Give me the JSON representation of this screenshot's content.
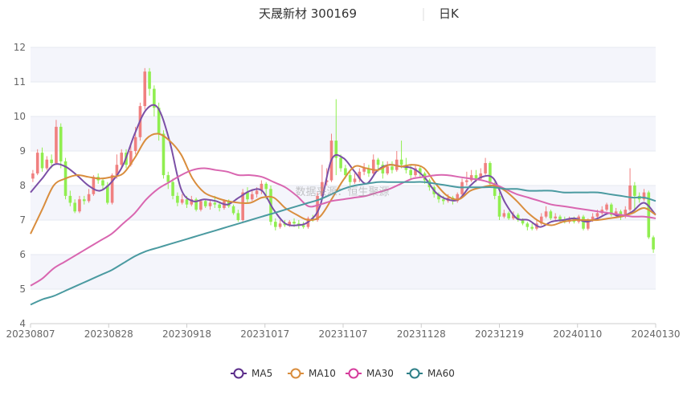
{
  "chart_data": {
    "type": "candlestick",
    "title": "天晟新材 300169",
    "period_label": "日K",
    "watermark": "数据来源：恒生聚源",
    "ylim": [
      4,
      12
    ],
    "y_ticks": [
      4,
      5,
      6,
      7,
      8,
      9,
      10,
      11,
      12
    ],
    "x_tick_labels": [
      "20230807",
      "20230828",
      "20230918",
      "20231017",
      "20231107",
      "20231128",
      "20231219",
      "20240110",
      "20240130"
    ],
    "colors": {
      "up": "#f08080",
      "down": "#90ee50",
      "grid": "#e6e9f2",
      "band": "#f4f5fb"
    },
    "candles": [
      [
        8.2,
        8.35,
        8.1,
        8.45
      ],
      [
        8.35,
        8.95,
        8.3,
        9.05
      ],
      [
        8.95,
        8.5,
        8.4,
        9.1
      ],
      [
        8.5,
        8.75,
        8.45,
        8.85
      ],
      [
        8.75,
        8.65,
        8.5,
        8.9
      ],
      [
        8.65,
        9.7,
        8.6,
        9.9
      ],
      [
        9.7,
        8.7,
        8.5,
        9.8
      ],
      [
        8.7,
        7.7,
        7.6,
        8.8
      ],
      [
        7.7,
        7.5,
        7.4,
        7.85
      ],
      [
        7.5,
        7.25,
        7.2,
        7.6
      ],
      [
        7.25,
        7.6,
        7.2,
        7.7
      ],
      [
        7.6,
        7.55,
        7.45,
        7.7
      ],
      [
        7.55,
        7.75,
        7.5,
        7.9
      ],
      [
        7.75,
        8.25,
        7.7,
        8.3
      ],
      [
        8.25,
        8.15,
        8.05,
        8.35
      ],
      [
        8.15,
        8.0,
        7.9,
        8.2
      ],
      [
        8.0,
        7.5,
        7.45,
        8.1
      ],
      [
        7.5,
        8.3,
        7.45,
        8.35
      ],
      [
        8.3,
        8.6,
        8.2,
        8.9
      ],
      [
        8.6,
        8.95,
        8.5,
        9.05
      ],
      [
        8.95,
        8.6,
        8.5,
        9.05
      ],
      [
        8.6,
        9.0,
        8.55,
        9.2
      ],
      [
        9.0,
        9.4,
        8.9,
        9.7
      ],
      [
        9.4,
        10.3,
        9.3,
        10.4
      ],
      [
        10.3,
        11.3,
        10.2,
        11.4
      ],
      [
        11.3,
        10.8,
        10.6,
        11.4
      ],
      [
        10.8,
        10.25,
        10.0,
        10.9
      ],
      [
        10.25,
        9.5,
        9.3,
        10.4
      ],
      [
        9.5,
        8.3,
        8.2,
        9.6
      ],
      [
        8.3,
        8.1,
        7.9,
        8.4
      ],
      [
        8.1,
        7.7,
        7.6,
        8.2
      ],
      [
        7.7,
        7.5,
        7.4,
        7.8
      ],
      [
        7.5,
        7.6,
        7.45,
        7.75
      ],
      [
        7.6,
        7.45,
        7.35,
        7.7
      ],
      [
        7.45,
        7.6,
        7.4,
        7.7
      ],
      [
        7.6,
        7.3,
        7.25,
        7.65
      ],
      [
        7.3,
        7.55,
        7.25,
        7.6
      ],
      [
        7.55,
        7.4,
        7.35,
        7.6
      ],
      [
        7.4,
        7.5,
        7.3,
        7.6
      ],
      [
        7.5,
        7.45,
        7.35,
        7.7
      ],
      [
        7.45,
        7.35,
        7.25,
        7.5
      ],
      [
        7.35,
        7.55,
        7.3,
        7.6
      ],
      [
        7.55,
        7.4,
        7.35,
        7.6
      ],
      [
        7.4,
        7.2,
        7.15,
        7.45
      ],
      [
        7.2,
        7.0,
        6.95,
        7.3
      ],
      [
        7.0,
        7.8,
        6.95,
        7.9
      ],
      [
        7.8,
        7.6,
        7.5,
        7.95
      ],
      [
        7.6,
        7.75,
        7.55,
        7.9
      ],
      [
        7.75,
        7.85,
        7.65,
        7.95
      ],
      [
        7.85,
        8.05,
        7.75,
        8.15
      ],
      [
        8.05,
        7.9,
        7.6,
        8.1
      ],
      [
        7.9,
        6.95,
        6.85,
        8.0
      ],
      [
        6.95,
        6.8,
        6.7,
        7.05
      ],
      [
        6.8,
        6.9,
        6.75,
        7.0
      ],
      [
        6.9,
        6.85,
        6.8,
        7.0
      ],
      [
        6.85,
        6.95,
        6.8,
        7.0
      ],
      [
        6.95,
        6.9,
        6.8,
        7.05
      ],
      [
        6.9,
        6.85,
        6.75,
        7.0
      ],
      [
        6.85,
        6.8,
        6.75,
        6.95
      ],
      [
        6.8,
        7.05,
        6.75,
        7.1
      ],
      [
        7.05,
        7.0,
        6.95,
        7.15
      ],
      [
        7.0,
        7.7,
        6.95,
        7.8
      ],
      [
        7.7,
        8.1,
        7.6,
        8.6
      ],
      [
        8.1,
        8.15,
        8.0,
        8.5
      ],
      [
        8.15,
        9.3,
        8.1,
        9.5
      ],
      [
        9.3,
        8.8,
        8.3,
        10.5
      ],
      [
        8.8,
        8.5,
        8.4,
        8.9
      ],
      [
        8.5,
        8.3,
        8.2,
        8.6
      ],
      [
        8.3,
        8.1,
        8.0,
        8.4
      ],
      [
        8.1,
        8.2,
        8.05,
        8.35
      ],
      [
        8.2,
        8.4,
        8.1,
        8.5
      ],
      [
        8.4,
        8.5,
        8.3,
        8.65
      ],
      [
        8.5,
        8.35,
        8.25,
        8.6
      ],
      [
        8.35,
        8.75,
        8.3,
        8.9
      ],
      [
        8.75,
        8.6,
        8.4,
        8.8
      ],
      [
        8.6,
        8.35,
        8.2,
        8.7
      ],
      [
        8.35,
        8.55,
        8.3,
        8.7
      ],
      [
        8.55,
        8.45,
        8.35,
        8.7
      ],
      [
        8.45,
        8.75,
        8.4,
        9.0
      ],
      [
        8.75,
        8.6,
        8.5,
        9.3
      ],
      [
        8.6,
        8.45,
        8.35,
        8.8
      ],
      [
        8.45,
        8.3,
        8.2,
        8.6
      ],
      [
        8.3,
        8.5,
        8.25,
        8.6
      ],
      [
        8.5,
        8.35,
        8.25,
        8.55
      ],
      [
        8.35,
        8.15,
        8.05,
        8.4
      ],
      [
        8.15,
        7.95,
        7.85,
        8.2
      ],
      [
        7.95,
        7.75,
        7.65,
        8.0
      ],
      [
        7.75,
        7.6,
        7.5,
        7.8
      ],
      [
        7.6,
        7.55,
        7.45,
        7.7
      ],
      [
        7.55,
        7.65,
        7.5,
        7.75
      ],
      [
        7.65,
        7.55,
        7.45,
        7.7
      ],
      [
        7.55,
        7.75,
        7.5,
        7.8
      ],
      [
        7.75,
        8.1,
        7.7,
        8.2
      ],
      [
        8.1,
        8.15,
        8.0,
        8.4
      ],
      [
        8.15,
        8.3,
        8.1,
        8.45
      ],
      [
        8.3,
        8.2,
        8.1,
        8.45
      ],
      [
        8.2,
        8.35,
        8.15,
        8.5
      ],
      [
        8.35,
        8.65,
        8.3,
        8.8
      ],
      [
        8.65,
        8.05,
        7.95,
        8.7
      ],
      [
        8.05,
        7.7,
        7.6,
        8.1
      ],
      [
        7.7,
        7.1,
        7.0,
        7.8
      ],
      [
        7.1,
        7.2,
        7.05,
        7.3
      ],
      [
        7.2,
        7.05,
        7.0,
        7.25
      ],
      [
        7.05,
        7.15,
        7.0,
        7.25
      ],
      [
        7.15,
        7.0,
        6.95,
        7.2
      ],
      [
        7.0,
        6.9,
        6.85,
        7.05
      ],
      [
        6.9,
        6.8,
        6.7,
        6.95
      ],
      [
        6.8,
        6.75,
        6.7,
        6.9
      ],
      [
        6.75,
        6.9,
        6.7,
        7.0
      ],
      [
        6.9,
        7.1,
        6.85,
        7.2
      ],
      [
        7.1,
        7.25,
        7.05,
        7.4
      ],
      [
        7.25,
        7.05,
        7.0,
        7.3
      ],
      [
        7.05,
        7.1,
        7.0,
        7.2
      ],
      [
        7.1,
        7.0,
        6.95,
        7.15
      ],
      [
        7.0,
        6.95,
        6.9,
        7.1
      ],
      [
        6.95,
        7.05,
        6.9,
        7.1
      ],
      [
        7.05,
        6.95,
        6.9,
        7.1
      ],
      [
        6.95,
        7.1,
        6.9,
        7.15
      ],
      [
        7.1,
        6.75,
        6.7,
        7.15
      ],
      [
        6.75,
        7.0,
        6.7,
        7.05
      ],
      [
        7.0,
        7.1,
        6.95,
        7.2
      ],
      [
        7.1,
        7.2,
        7.05,
        7.3
      ],
      [
        7.2,
        7.3,
        7.15,
        7.4
      ],
      [
        7.3,
        7.45,
        7.25,
        7.5
      ],
      [
        7.45,
        7.15,
        7.1,
        7.5
      ],
      [
        7.15,
        7.25,
        7.1,
        7.35
      ],
      [
        7.25,
        7.1,
        7.0,
        7.3
      ],
      [
        7.1,
        7.3,
        7.05,
        7.4
      ],
      [
        7.3,
        8.0,
        7.25,
        8.5
      ],
      [
        8.0,
        7.7,
        7.2,
        8.1
      ],
      [
        7.7,
        7.6,
        7.5,
        7.8
      ],
      [
        7.6,
        7.8,
        7.55,
        7.9
      ],
      [
        7.8,
        6.5,
        6.45,
        7.85
      ],
      [
        6.5,
        6.15,
        6.05,
        6.55
      ]
    ],
    "series": [
      {
        "name": "MA5",
        "color": "#7b4fa6",
        "values": [
          7.8,
          8.2,
          8.6,
          8.55,
          8.3,
          8.0,
          7.85,
          8.1,
          8.6,
          9.5,
          10.2,
          10.25,
          9.3,
          7.9,
          7.55,
          7.6,
          7.55,
          7.45,
          7.65,
          7.85,
          7.85,
          7.3,
          6.9,
          6.85,
          6.95,
          7.4,
          8.75,
          8.8,
          8.4,
          8.05,
          8.45,
          8.6,
          8.55,
          8.5,
          8.25,
          7.8,
          7.6,
          7.6,
          8.0,
          8.25,
          8.2,
          7.5,
          7.05,
          7.0,
          6.8,
          6.95,
          7.0,
          7.05,
          6.95,
          7.05,
          7.2,
          7.1,
          7.25,
          7.5,
          7.15
        ]
      },
      {
        "name": "MA10",
        "color": "#d98d3d",
        "values": [
          6.6,
          7.3,
          8.0,
          8.2,
          8.3,
          8.25,
          8.2,
          8.25,
          8.35,
          8.8,
          9.35,
          9.5,
          9.3,
          8.9,
          8.2,
          7.8,
          7.65,
          7.55,
          7.5,
          7.5,
          7.65,
          7.65,
          7.35,
          7.15,
          7.0,
          7.1,
          7.6,
          8.15,
          8.55,
          8.5,
          8.45,
          8.6,
          8.55,
          8.6,
          8.5,
          8.05,
          7.7,
          7.6,
          7.85,
          7.95,
          8.0,
          7.85,
          7.55,
          7.2,
          6.95,
          6.85,
          6.95,
          7.0,
          7.0,
          7.0,
          7.05,
          7.1,
          7.2,
          7.35,
          7.15
        ]
      },
      {
        "name": "MA30",
        "color": "#d966b0",
        "values": [
          5.1,
          5.3,
          5.6,
          5.8,
          6.0,
          6.2,
          6.4,
          6.6,
          6.9,
          7.2,
          7.6,
          7.9,
          8.1,
          8.3,
          8.45,
          8.5,
          8.45,
          8.4,
          8.3,
          8.3,
          8.25,
          8.1,
          7.95,
          7.7,
          7.4,
          7.45,
          7.55,
          7.6,
          7.65,
          7.7,
          7.8,
          7.9,
          8.05,
          8.2,
          8.25,
          8.3,
          8.3,
          8.25,
          8.2,
          8.15,
          8.05,
          7.9,
          7.75,
          7.65,
          7.55,
          7.45,
          7.4,
          7.35,
          7.3,
          7.25,
          7.2,
          7.15,
          7.1,
          7.1,
          7.05
        ]
      },
      {
        "name": "MA60",
        "color": "#4a9aa0",
        "values": [
          4.55,
          4.7,
          4.8,
          4.95,
          5.1,
          5.25,
          5.4,
          5.55,
          5.75,
          5.95,
          6.1,
          6.2,
          6.3,
          6.4,
          6.5,
          6.6,
          6.7,
          6.8,
          6.9,
          7.0,
          7.1,
          7.2,
          7.3,
          7.4,
          7.5,
          7.6,
          7.75,
          7.9,
          8.0,
          8.05,
          8.1,
          8.1,
          8.1,
          8.1,
          8.1,
          8.05,
          8.0,
          7.95,
          7.95,
          7.95,
          7.95,
          7.9,
          7.9,
          7.85,
          7.85,
          7.85,
          7.8,
          7.8,
          7.8,
          7.8,
          7.75,
          7.7,
          7.65,
          7.65,
          7.55
        ]
      }
    ],
    "legend": [
      {
        "name": "MA5",
        "color": "#5b2d8a"
      },
      {
        "name": "MA10",
        "color": "#d98d3d"
      },
      {
        "name": "MA30",
        "color": "#d63c9c"
      },
      {
        "name": "MA60",
        "color": "#2e7f87"
      }
    ]
  }
}
